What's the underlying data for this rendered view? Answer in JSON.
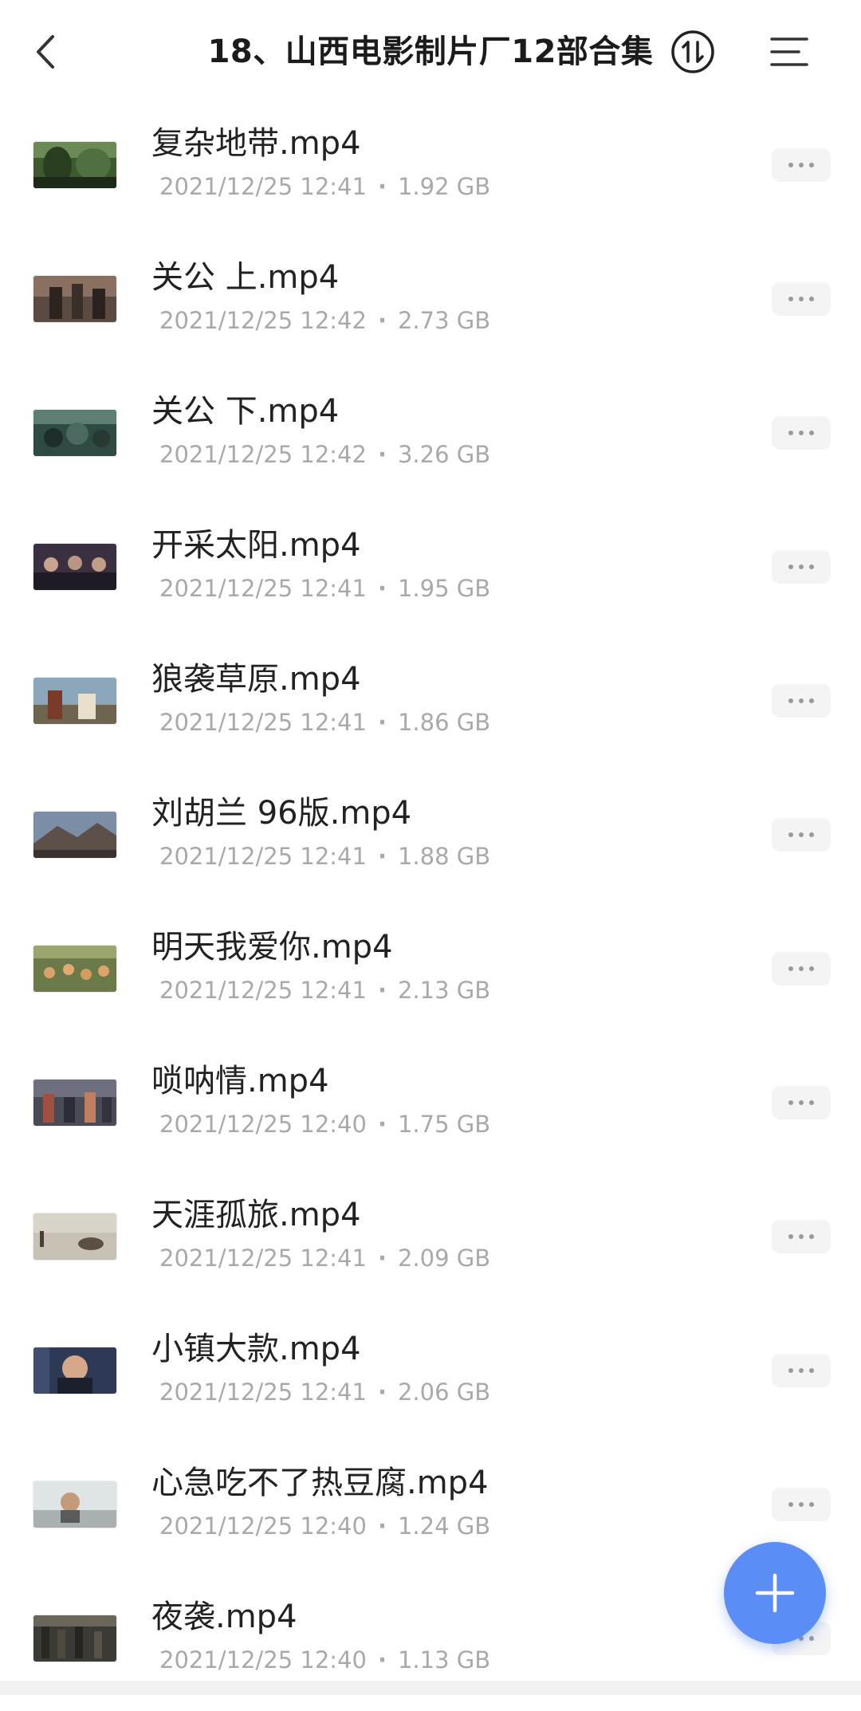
{
  "header": {
    "title": "18、山西电影制片厂12部合集",
    "back_icon": "chevron-left-icon",
    "sort_icon": "sort-icon",
    "menu_icon": "menu-lines-icon"
  },
  "colors": {
    "accent": "#5a8df5",
    "text_primary": "#222222",
    "text_secondary": "#a9a9a9"
  },
  "files": [
    {
      "name": "复杂地带.mp4",
      "date": "2021/12/25 12:41",
      "size": "1.92 GB"
    },
    {
      "name": "关公 上.mp4",
      "date": "2021/12/25 12:42",
      "size": "2.73 GB"
    },
    {
      "name": "关公 下.mp4",
      "date": "2021/12/25 12:42",
      "size": "3.26 GB"
    },
    {
      "name": "开采太阳.mp4",
      "date": "2021/12/25 12:41",
      "size": "1.95 GB"
    },
    {
      "name": "狼袭草原.mp4",
      "date": "2021/12/25 12:41",
      "size": "1.86 GB"
    },
    {
      "name": "刘胡兰 96版.mp4",
      "date": "2021/12/25 12:41",
      "size": "1.88 GB"
    },
    {
      "name": "明天我爱你.mp4",
      "date": "2021/12/25 12:41",
      "size": "2.13 GB"
    },
    {
      "name": "唢呐情.mp4",
      "date": "2021/12/25 12:40",
      "size": "1.75 GB"
    },
    {
      "name": "天涯孤旅.mp4",
      "date": "2021/12/25 12:41",
      "size": "2.09 GB"
    },
    {
      "name": "小镇大款.mp4",
      "date": "2021/12/25 12:41",
      "size": "2.06 GB"
    },
    {
      "name": "心急吃不了热豆腐.mp4",
      "date": "2021/12/25 12:40",
      "size": "1.24 GB"
    },
    {
      "name": "夜袭.mp4",
      "date": "2021/12/25 12:40",
      "size": "1.13 GB"
    }
  ],
  "meta_separator": "·",
  "fab": {
    "icon": "plus-icon"
  }
}
